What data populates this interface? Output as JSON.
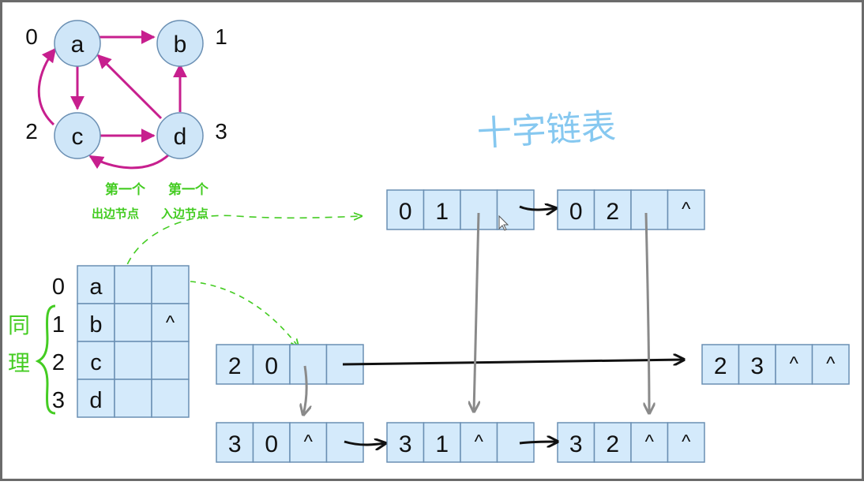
{
  "graph": {
    "nodes": [
      {
        "id": "a",
        "label": "a",
        "index": "0"
      },
      {
        "id": "b",
        "label": "b",
        "index": "1"
      },
      {
        "id": "c",
        "label": "c",
        "index": "2"
      },
      {
        "id": "d",
        "label": "d",
        "index": "3"
      }
    ],
    "edges": [
      {
        "from": "a",
        "to": "b"
      },
      {
        "from": "a",
        "to": "c"
      },
      {
        "from": "c",
        "to": "a"
      },
      {
        "from": "c",
        "to": "d"
      },
      {
        "from": "d",
        "to": "a"
      },
      {
        "from": "d",
        "to": "b"
      },
      {
        "from": "d",
        "to": "c"
      }
    ]
  },
  "title": "十字链表",
  "annotations": {
    "first_out_l1": "第一个",
    "first_out_l2": "出边节点",
    "first_in_l1": "第一个",
    "first_in_l2": "入边节点",
    "same_char1": "同",
    "same_char2": "理"
  },
  "vertex_table": {
    "rows": [
      {
        "index": "0",
        "label": "a",
        "firstin": "",
        "firstout": ""
      },
      {
        "index": "1",
        "label": "b",
        "firstin": "",
        "firstout": "^"
      },
      {
        "index": "2",
        "label": "c",
        "firstin": "",
        "firstout": ""
      },
      {
        "index": "3",
        "label": "d",
        "firstin": "",
        "firstout": ""
      }
    ]
  },
  "arc_nodes": [
    {
      "id": "arc01",
      "cells": [
        "0",
        "1",
        "",
        ""
      ]
    },
    {
      "id": "arc02",
      "cells": [
        "0",
        "2",
        "",
        "^"
      ]
    },
    {
      "id": "arc20",
      "cells": [
        "2",
        "0",
        "",
        ""
      ]
    },
    {
      "id": "arc23",
      "cells": [
        "2",
        "3",
        "^",
        "^"
      ]
    },
    {
      "id": "arc30",
      "cells": [
        "3",
        "0",
        "^",
        ""
      ]
    },
    {
      "id": "arc31",
      "cells": [
        "3",
        "1",
        "^",
        ""
      ]
    },
    {
      "id": "arc32",
      "cells": [
        "3",
        "2",
        "^",
        "^"
      ]
    }
  ],
  "colors": {
    "node_fill": "#cfe6f8",
    "node_stroke": "#6a8fb3",
    "edge": "#c71f8e",
    "cell_fill": "#d4eafb",
    "cell_stroke": "#6a8fb3",
    "title": "#86c8f0",
    "green": "#44cc22",
    "gray": "#8a8a8a",
    "black": "#111111"
  }
}
